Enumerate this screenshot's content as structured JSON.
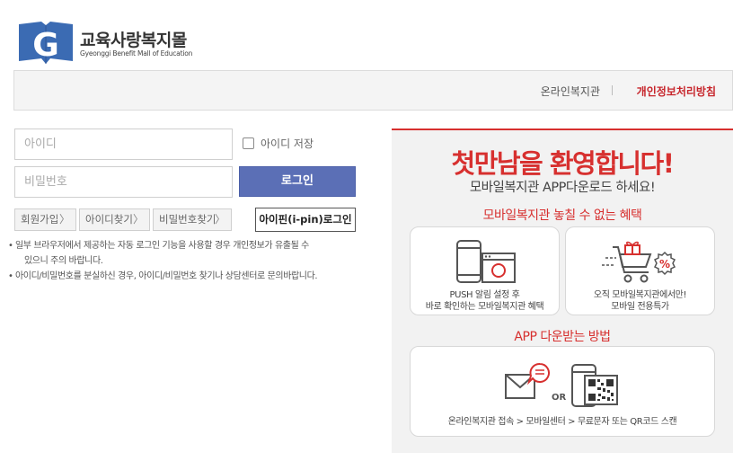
{
  "logo": {
    "mark_letter": "G",
    "title": "교육사랑복지몰",
    "subtitle": "Gyeonggi Benefit Mall of Education"
  },
  "topbar": {
    "online_link": "온라인복지관",
    "privacy_link": "개인정보처리방침"
  },
  "login": {
    "id_placeholder": "아이디",
    "pw_placeholder": "비밀번호",
    "save_id_label": "아이디 저장",
    "login_button": "로그인",
    "join_label": "회원가입",
    "find_id_label": "아이디찾기",
    "find_pw_label": "비밀번호찾기",
    "ipin_label": "아이핀(i-pin)로그인",
    "chevron": "〉"
  },
  "notes": [
    {
      "bullet": "•",
      "line1": "일부 브라우저에서 제공하는 자동 로그인 기능을 사용할 경우 개인정보가 유출될 수",
      "line2": "있으니 주의 바랍니다."
    },
    {
      "bullet": "•",
      "line1": "아이디/비밀번호를 분실하신 경우, 아이디/비밀번호 찾기나 상담센터로 문의바랍니다."
    }
  ],
  "promo": {
    "welcome": "첫만남을 환영합니다!",
    "subtitle": "모바일복지관 APP다운로드 하세요!",
    "benefits_title": "모바일복지관 놓칠 수 없는 혜택",
    "card1_line1": "PUSH 알림 설정 후",
    "card1_line2": "바로 확인하는 모바일복지관 혜택",
    "card2_line1": "오직 모바일복지관에서만!",
    "card2_line2": "모바일 전용특가",
    "download_title": "APP 다운받는 방법",
    "or_label": "OR",
    "card3_text": "온라인복지관 접속 > 모바일센터 > 무료문자 또는 QR코드 스캔"
  },
  "colors": {
    "accent_red": "#d7302f",
    "login_blue": "#5b6fb6",
    "logo_blue": "#3b6bb3"
  }
}
